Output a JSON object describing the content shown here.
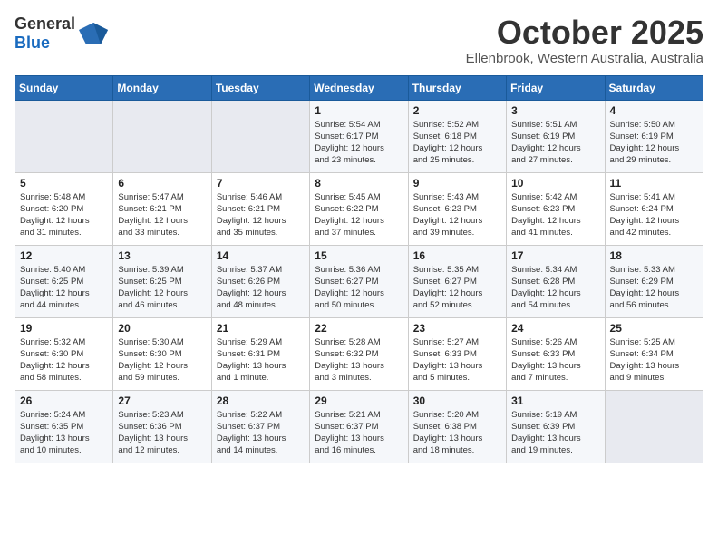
{
  "header": {
    "logo_general": "General",
    "logo_blue": "Blue",
    "title": "October 2025",
    "subtitle": "Ellenbrook, Western Australia, Australia"
  },
  "days_of_week": [
    "Sunday",
    "Monday",
    "Tuesday",
    "Wednesday",
    "Thursday",
    "Friday",
    "Saturday"
  ],
  "weeks": [
    [
      {
        "num": "",
        "detail": ""
      },
      {
        "num": "",
        "detail": ""
      },
      {
        "num": "",
        "detail": ""
      },
      {
        "num": "1",
        "detail": "Sunrise: 5:54 AM\nSunset: 6:17 PM\nDaylight: 12 hours\nand 23 minutes."
      },
      {
        "num": "2",
        "detail": "Sunrise: 5:52 AM\nSunset: 6:18 PM\nDaylight: 12 hours\nand 25 minutes."
      },
      {
        "num": "3",
        "detail": "Sunrise: 5:51 AM\nSunset: 6:19 PM\nDaylight: 12 hours\nand 27 minutes."
      },
      {
        "num": "4",
        "detail": "Sunrise: 5:50 AM\nSunset: 6:19 PM\nDaylight: 12 hours\nand 29 minutes."
      }
    ],
    [
      {
        "num": "5",
        "detail": "Sunrise: 5:48 AM\nSunset: 6:20 PM\nDaylight: 12 hours\nand 31 minutes."
      },
      {
        "num": "6",
        "detail": "Sunrise: 5:47 AM\nSunset: 6:21 PM\nDaylight: 12 hours\nand 33 minutes."
      },
      {
        "num": "7",
        "detail": "Sunrise: 5:46 AM\nSunset: 6:21 PM\nDaylight: 12 hours\nand 35 minutes."
      },
      {
        "num": "8",
        "detail": "Sunrise: 5:45 AM\nSunset: 6:22 PM\nDaylight: 12 hours\nand 37 minutes."
      },
      {
        "num": "9",
        "detail": "Sunrise: 5:43 AM\nSunset: 6:23 PM\nDaylight: 12 hours\nand 39 minutes."
      },
      {
        "num": "10",
        "detail": "Sunrise: 5:42 AM\nSunset: 6:23 PM\nDaylight: 12 hours\nand 41 minutes."
      },
      {
        "num": "11",
        "detail": "Sunrise: 5:41 AM\nSunset: 6:24 PM\nDaylight: 12 hours\nand 42 minutes."
      }
    ],
    [
      {
        "num": "12",
        "detail": "Sunrise: 5:40 AM\nSunset: 6:25 PM\nDaylight: 12 hours\nand 44 minutes."
      },
      {
        "num": "13",
        "detail": "Sunrise: 5:39 AM\nSunset: 6:25 PM\nDaylight: 12 hours\nand 46 minutes."
      },
      {
        "num": "14",
        "detail": "Sunrise: 5:37 AM\nSunset: 6:26 PM\nDaylight: 12 hours\nand 48 minutes."
      },
      {
        "num": "15",
        "detail": "Sunrise: 5:36 AM\nSunset: 6:27 PM\nDaylight: 12 hours\nand 50 minutes."
      },
      {
        "num": "16",
        "detail": "Sunrise: 5:35 AM\nSunset: 6:27 PM\nDaylight: 12 hours\nand 52 minutes."
      },
      {
        "num": "17",
        "detail": "Sunrise: 5:34 AM\nSunset: 6:28 PM\nDaylight: 12 hours\nand 54 minutes."
      },
      {
        "num": "18",
        "detail": "Sunrise: 5:33 AM\nSunset: 6:29 PM\nDaylight: 12 hours\nand 56 minutes."
      }
    ],
    [
      {
        "num": "19",
        "detail": "Sunrise: 5:32 AM\nSunset: 6:30 PM\nDaylight: 12 hours\nand 58 minutes."
      },
      {
        "num": "20",
        "detail": "Sunrise: 5:30 AM\nSunset: 6:30 PM\nDaylight: 12 hours\nand 59 minutes."
      },
      {
        "num": "21",
        "detail": "Sunrise: 5:29 AM\nSunset: 6:31 PM\nDaylight: 13 hours\nand 1 minute."
      },
      {
        "num": "22",
        "detail": "Sunrise: 5:28 AM\nSunset: 6:32 PM\nDaylight: 13 hours\nand 3 minutes."
      },
      {
        "num": "23",
        "detail": "Sunrise: 5:27 AM\nSunset: 6:33 PM\nDaylight: 13 hours\nand 5 minutes."
      },
      {
        "num": "24",
        "detail": "Sunrise: 5:26 AM\nSunset: 6:33 PM\nDaylight: 13 hours\nand 7 minutes."
      },
      {
        "num": "25",
        "detail": "Sunrise: 5:25 AM\nSunset: 6:34 PM\nDaylight: 13 hours\nand 9 minutes."
      }
    ],
    [
      {
        "num": "26",
        "detail": "Sunrise: 5:24 AM\nSunset: 6:35 PM\nDaylight: 13 hours\nand 10 minutes."
      },
      {
        "num": "27",
        "detail": "Sunrise: 5:23 AM\nSunset: 6:36 PM\nDaylight: 13 hours\nand 12 minutes."
      },
      {
        "num": "28",
        "detail": "Sunrise: 5:22 AM\nSunset: 6:37 PM\nDaylight: 13 hours\nand 14 minutes."
      },
      {
        "num": "29",
        "detail": "Sunrise: 5:21 AM\nSunset: 6:37 PM\nDaylight: 13 hours\nand 16 minutes."
      },
      {
        "num": "30",
        "detail": "Sunrise: 5:20 AM\nSunset: 6:38 PM\nDaylight: 13 hours\nand 18 minutes."
      },
      {
        "num": "31",
        "detail": "Sunrise: 5:19 AM\nSunset: 6:39 PM\nDaylight: 13 hours\nand 19 minutes."
      },
      {
        "num": "",
        "detail": ""
      }
    ]
  ]
}
